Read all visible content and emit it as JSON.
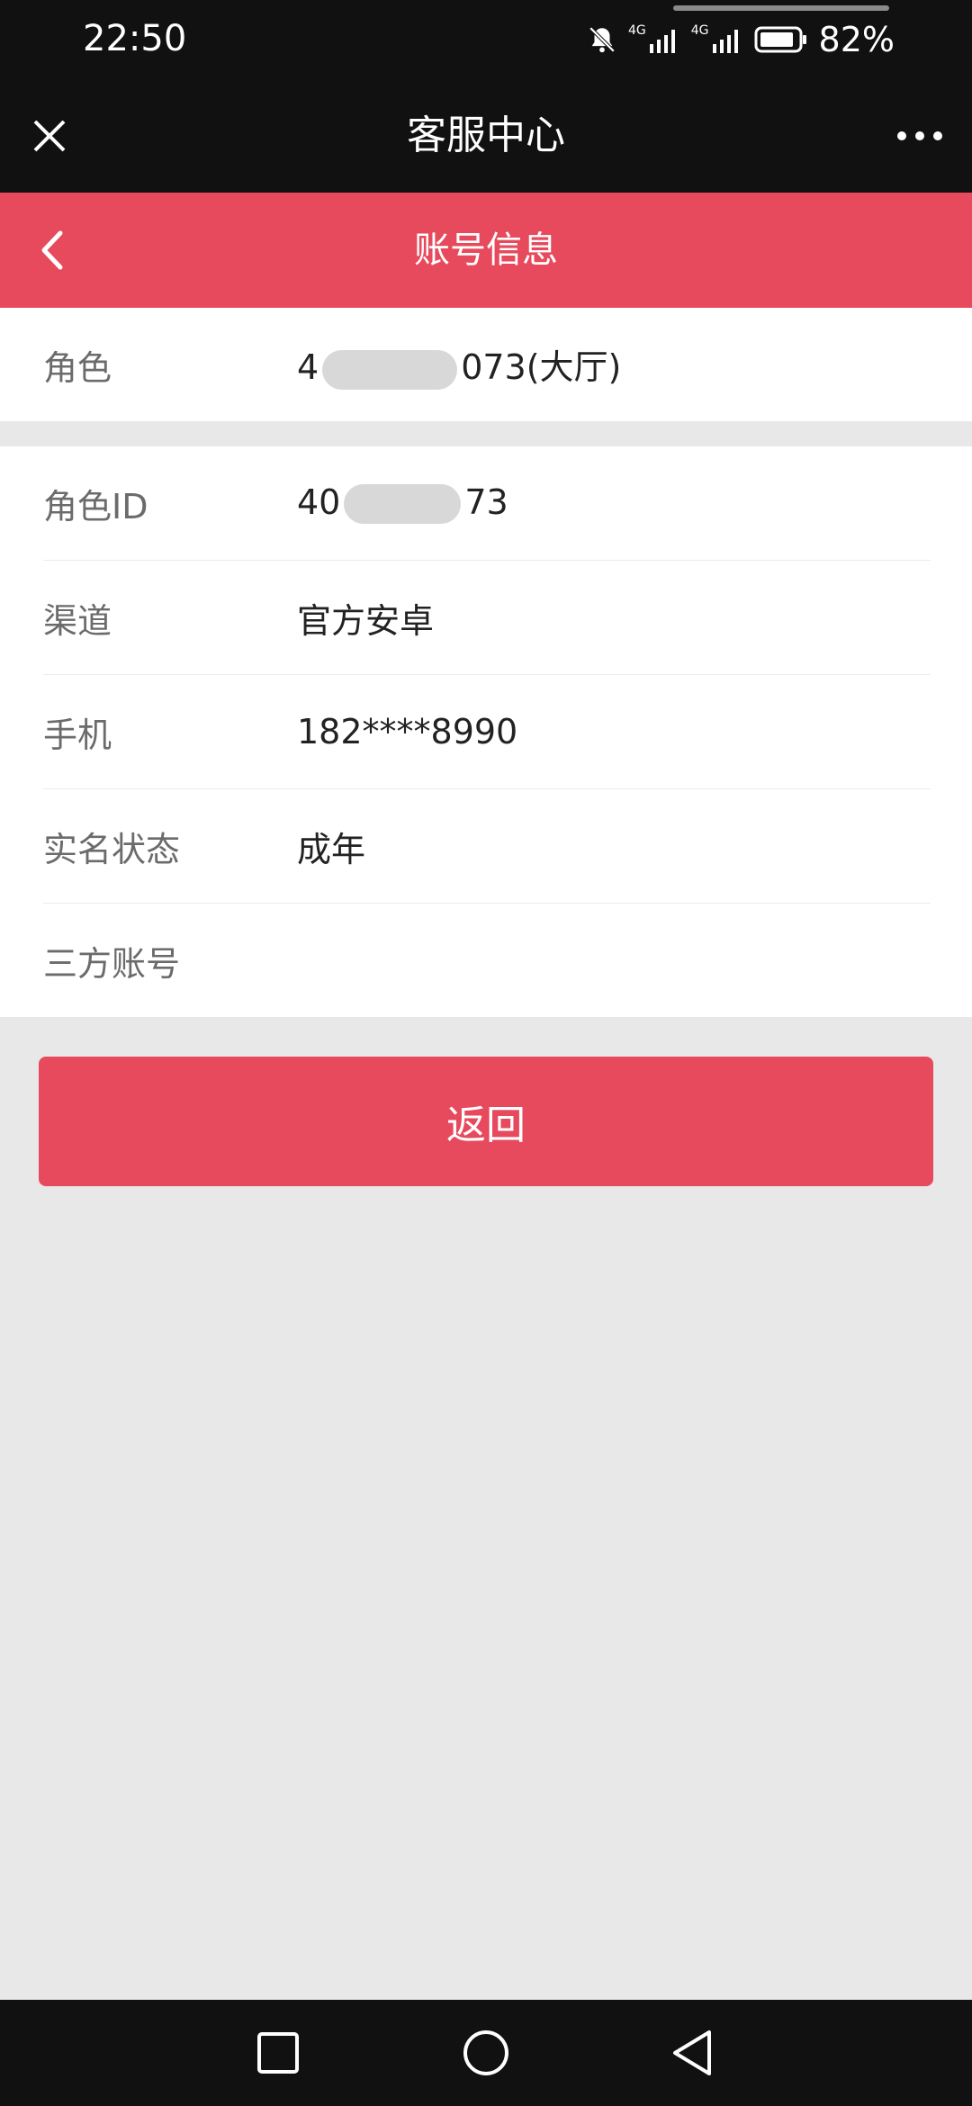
{
  "status_bar": {
    "time": "22:50",
    "net_tag_1": "4G",
    "net_tag_2": "4G",
    "battery": "82%",
    "icons": [
      "bell-off-icon",
      "signal-icon",
      "signal-icon",
      "battery-icon"
    ]
  },
  "mini_program": {
    "title": "客服中心",
    "close_icon": "close-icon",
    "more_icon": "more-icon"
  },
  "page_header": {
    "title": "账号信息",
    "back_icon": "chevron-left-icon"
  },
  "role_row": {
    "label": "角色",
    "value_prefix": "4",
    "value_suffix": "073(大厅)"
  },
  "details": [
    {
      "label": "角色ID",
      "value_prefix": "40",
      "value_suffix": "73"
    },
    {
      "label": "渠道",
      "value": "官方安卓"
    },
    {
      "label": "手机",
      "value": "182****8990"
    },
    {
      "label": "实名状态",
      "value": "成年"
    },
    {
      "label": "三方账号",
      "value": ""
    }
  ],
  "return_button": "返回",
  "nav_bar": {
    "icons": [
      "square-icon",
      "circle-icon",
      "triangle-back-icon"
    ]
  },
  "colors": {
    "accent": "#e64a5c",
    "dark_bar": "#111111",
    "background": "#e8e8e8"
  }
}
